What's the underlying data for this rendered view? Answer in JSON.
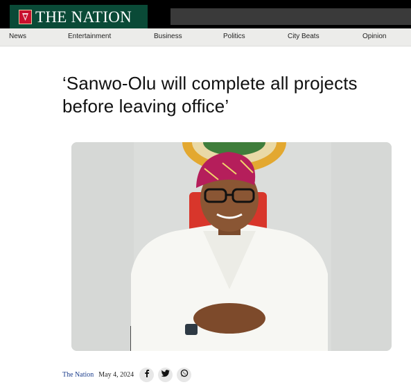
{
  "header": {
    "site_name": "THE NATION",
    "brand_color": "#0a4a37",
    "accent_color": "#c8102e"
  },
  "nav": {
    "items": [
      {
        "label": "News"
      },
      {
        "label": "Entertainment"
      },
      {
        "label": "Business"
      },
      {
        "label": "Politics"
      },
      {
        "label": "City Beats"
      },
      {
        "label": "Opinion"
      }
    ]
  },
  "article": {
    "headline": "‘Sanwo-Olu will complete all projects before leaving office’",
    "author": "The Nation",
    "date": "May 4, 2024",
    "share_icons": [
      "facebook-icon",
      "twitter-icon",
      "whatsapp-icon"
    ]
  }
}
